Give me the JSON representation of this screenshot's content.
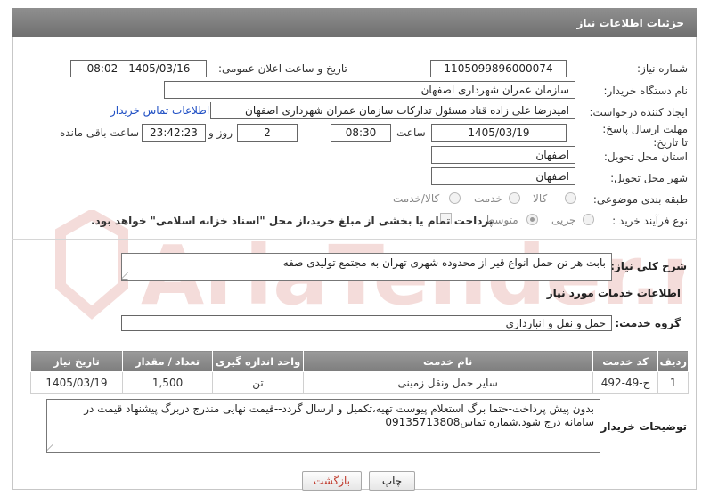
{
  "header": {
    "title": "جزئیات اطلاعات نیاز"
  },
  "fields": {
    "need_number_label": "شماره نیاز:",
    "need_number": "1105099896000074",
    "announce_label": "تاریخ و ساعت اعلان عمومی:",
    "announce_value": "1405/03/16 - 08:02",
    "buyer_org_label": "نام دستگاه خریدار:",
    "buyer_org": "سازمان عمران شهرداری اصفهان",
    "creator_label": "ایجاد کننده درخواست:",
    "creator": "امیدرضا علی زاده قناد مسئول تدارکات سازمان عمران شهرداری اصفهان",
    "contact_link": "اطلاعات تماس خریدار",
    "deadline_label": "مهلت ارسال پاسخ: تا تاریخ:",
    "deadline_date": "1405/03/19",
    "time_label": "ساعت",
    "deadline_time": "08:30",
    "days_value": "2",
    "days_label": "روز و",
    "remaining_time": "23:42:23",
    "remaining_label": "ساعت باقی مانده",
    "province_label": "استان محل تحویل:",
    "province": "اصفهان",
    "city_label": "شهر محل تحویل:",
    "city": "اصفهان",
    "category_label": "طبقه بندی موضوعی:",
    "category_options": [
      "کالا",
      "خدمت",
      "کالا/خدمت"
    ],
    "process_label": "نوع فرآیند خرید :",
    "process_options": [
      "جزیی",
      "متوسط"
    ],
    "treasury_note": "پرداخت تمام یا بخشی از مبلغ خرید،از محل \"اسناد خزانه اسلامی\" خواهد بود."
  },
  "summary": {
    "label": "شرح کلي نياز:",
    "text": "بابت هر تن حمل  انواع قیر از محدوده شهری تهران به مجتمع تولیدی صفه"
  },
  "services": {
    "section_title": "اطلاعات خدمات مورد نیاز",
    "group_label": "گروه خدمت:",
    "group_value": "حمل و نقل و انبارداری",
    "columns": [
      "ردیف",
      "کد خدمت",
      "نام خدمت",
      "واحد اندازه گیری",
      "تعداد / مقدار",
      "تاریخ نیاز"
    ],
    "rows": [
      [
        "1",
        "ح-49-492",
        "سایر حمل ونقل زمینی",
        "تن",
        "1,500",
        "1405/03/19"
      ]
    ]
  },
  "buyer_notes": {
    "label": "توضیحات خریدار:",
    "text": "بدون پیش پرداخت-حتما برگ استعلام پیوست تهیه،تکمیل و ارسال گردد--قیمت نهایی مندرج دربرگ پیشنهاد قیمت در سامانه درج شود.شمارە تماس09135713808"
  },
  "buttons": {
    "print": "چاپ",
    "back": "بازگشت"
  },
  "watermark": {
    "text": "AriaTender.net"
  },
  "colors": {
    "header_bg": "#7d7d7d",
    "link": "#1f4fc4",
    "back_text": "#c0392b"
  }
}
